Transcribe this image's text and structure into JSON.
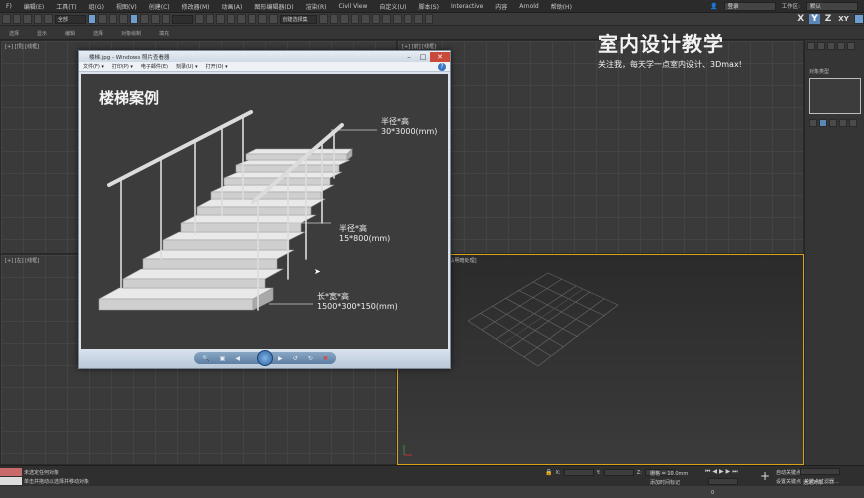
{
  "menubar": {
    "items": [
      "F)",
      "编辑(E)",
      "工具(T)",
      "组(G)",
      "视图(V)",
      "创建(C)",
      "修改器(M)",
      "动画(A)",
      "图形编辑器(D)",
      "渲染(R)",
      "Civil View",
      "自定义(U)",
      "脚本(S)",
      "Interactive",
      "内容",
      "Arnold",
      "帮助(H)"
    ],
    "user": "登录",
    "workspace_label": "工作区:",
    "workspace_value": "默认"
  },
  "toolbar": {
    "filter_dropdown": "全部",
    "set_dropdown": "创建选择集",
    "axis_x": "X",
    "axis_y": "Y",
    "axis_z": "Z",
    "axis_xy": "XY"
  },
  "ribbon": {
    "tabs": [
      "选择",
      "显示",
      "编辑",
      "选择",
      "对象绘制",
      "填充"
    ]
  },
  "viewports": {
    "top_left": "[+] [顶] [线框]",
    "top_right": "[+] [前] [线框]",
    "bottom_left": "[+] [左] [线框]",
    "bottom_right": "[+] [透视] [标准] [默认明暗处理]"
  },
  "command_panel": {
    "label": "对象类型"
  },
  "watermark": {
    "title": "室内设计教学",
    "subtitle": "关注我，每天学一点室内设计、3Dmax!"
  },
  "viewer": {
    "title": "楼梯.jpg - Windows 照片查看器",
    "menu": [
      "文件(F) ▾",
      "打印(P) ▾",
      "电子邮件(E)",
      "刻录(U) ▾",
      "打开(O) ▾"
    ],
    "help": "?",
    "image_title": "楼梯案例",
    "annotations": {
      "handrail_label": "半径*高",
      "handrail_value": "30*3000(mm)",
      "baluster_label": "半径*高",
      "baluster_value": "15*800(mm)",
      "step_label": "长*宽*高",
      "step_value": "1500*300*150(mm)"
    }
  },
  "status": {
    "left_top": "未选定任何对象",
    "left_bottom": "单击并拖动以选择并移动对象",
    "coord_x_label": "X:",
    "coord_y_label": "Y:",
    "coord_z_label": "Z:",
    "grid": "栅格 = 10.0mm",
    "time_tag": "添加时间标记",
    "autokey": "自动关键点",
    "selected": "选定对象",
    "setkey": "设置关键点",
    "keyfilter": "关键点过滤器...",
    "frame": "0"
  }
}
